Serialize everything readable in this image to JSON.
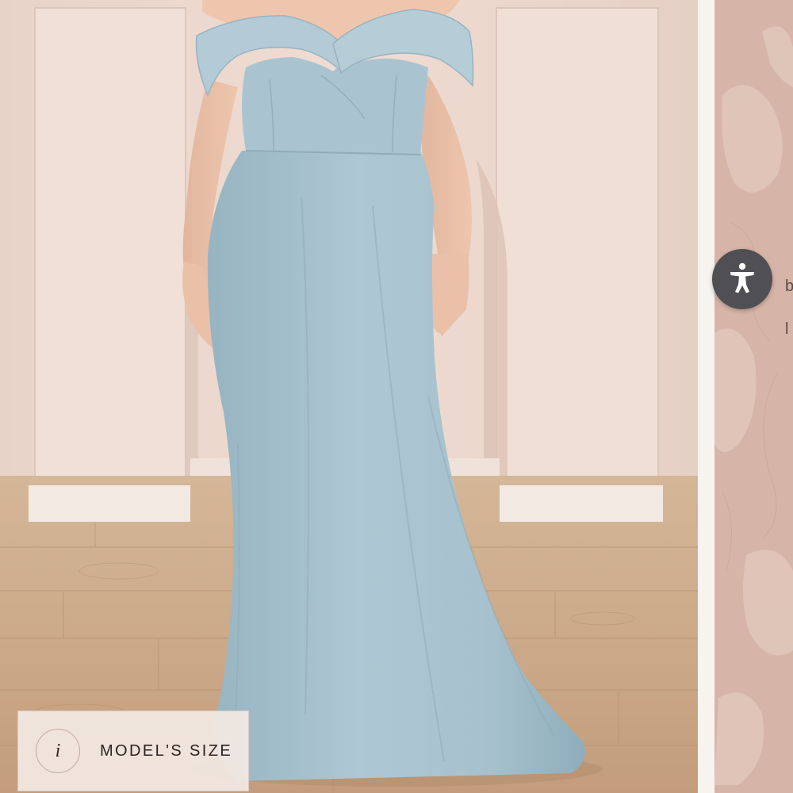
{
  "gallery": {
    "main_image_alt": "Dusty blue off-the-shoulder crepe gown",
    "model_size_label": "MODEL'S SIZE",
    "info_icon_glyph": "i",
    "side_peek_text": [
      "b",
      "l"
    ]
  },
  "accessibility": {
    "icon": "accessibility-person-icon"
  },
  "colors": {
    "dress": "#a9c4cf",
    "wall": "#ecd9cf",
    "floor": "#c9a886",
    "a11y_button": "#4f4f54",
    "thumbnail_bg": "#d8b7ab"
  }
}
